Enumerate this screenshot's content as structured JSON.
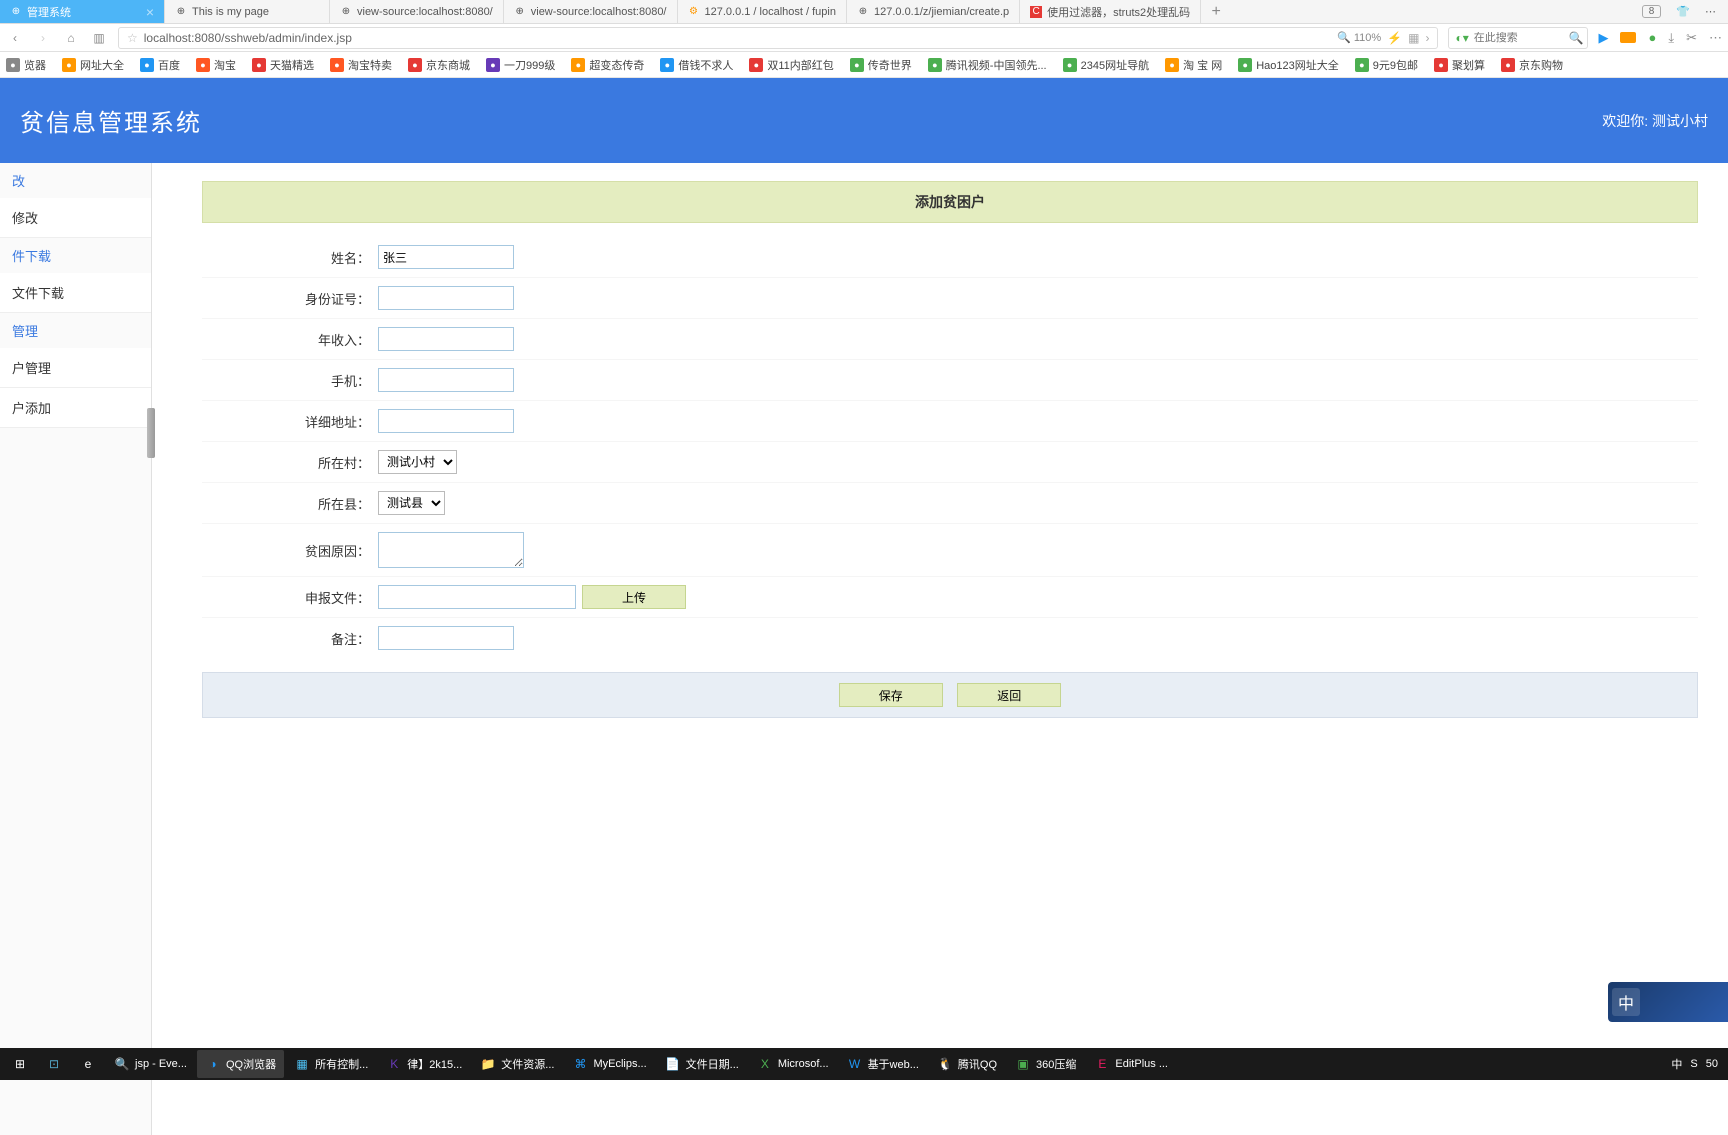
{
  "browser": {
    "tabs": [
      {
        "label": "管理系统",
        "active": true
      },
      {
        "label": "This is my page",
        "active": false
      },
      {
        "label": "view-source:localhost:8080/",
        "active": false
      },
      {
        "label": "view-source:localhost:8080/",
        "active": false
      },
      {
        "label": "127.0.0.1 / localhost / fupin",
        "active": false
      },
      {
        "label": "127.0.0.1/z/jiemian/create.p",
        "active": false
      },
      {
        "label": "使用过滤器，struts2处理乱码",
        "active": false
      }
    ],
    "tab_count": "8",
    "url": "localhost:8080/sshweb/admin/index.jsp",
    "zoom": "110%",
    "search_placeholder": "在此搜索"
  },
  "bookmarks": [
    {
      "label": "览器",
      "color": "#888"
    },
    {
      "label": "网址大全",
      "color": "#ff9800"
    },
    {
      "label": "百度",
      "color": "#2196f3"
    },
    {
      "label": "淘宝",
      "color": "#ff5722"
    },
    {
      "label": "天猫精选",
      "color": "#e53935"
    },
    {
      "label": "淘宝特卖",
      "color": "#ff5722"
    },
    {
      "label": "京东商城",
      "color": "#e53935"
    },
    {
      "label": "一刀999级",
      "color": "#673ab7"
    },
    {
      "label": "超变态传奇",
      "color": "#ff9800"
    },
    {
      "label": "借钱不求人",
      "color": "#2196f3"
    },
    {
      "label": "双11内部红包",
      "color": "#e53935"
    },
    {
      "label": "传奇世界",
      "color": "#4caf50"
    },
    {
      "label": "腾讯视频-中国领先...",
      "color": "#4caf50"
    },
    {
      "label": "2345网址导航",
      "color": "#4caf50"
    },
    {
      "label": "淘 宝 网",
      "color": "#ff9800"
    },
    {
      "label": "Hao123网址大全",
      "color": "#4caf50"
    },
    {
      "label": "9元9包邮",
      "color": "#4caf50"
    },
    {
      "label": "聚划算",
      "color": "#e53935"
    },
    {
      "label": "京东购物",
      "color": "#e53935"
    }
  ],
  "header": {
    "title": "贫信息管理系统",
    "welcome_prefix": "欢迎你: ",
    "welcome_user": "测试小村"
  },
  "sidebar": {
    "groups": [
      {
        "label": "改",
        "items": [
          "修改"
        ]
      },
      {
        "label": "件下载",
        "items": [
          "文件下载"
        ]
      },
      {
        "label": "管理",
        "items": [
          "户管理",
          "户添加"
        ]
      }
    ]
  },
  "form": {
    "title": "添加贫困户",
    "fields": {
      "name": {
        "label": "姓名：",
        "value": "张三"
      },
      "idcard": {
        "label": "身份证号：",
        "value": ""
      },
      "income": {
        "label": "年收入：",
        "value": ""
      },
      "phone": {
        "label": "手机：",
        "value": ""
      },
      "address": {
        "label": "详细地址：",
        "value": ""
      },
      "village": {
        "label": "所在村：",
        "value": "测试小村",
        "options": [
          "测试小村"
        ]
      },
      "county": {
        "label": "所在县：",
        "value": "测试县",
        "options": [
          "测试县"
        ]
      },
      "reason": {
        "label": "贫困原因：",
        "value": ""
      },
      "file": {
        "label": "申报文件：",
        "upload_label": "上传"
      },
      "remark": {
        "label": "备注：",
        "value": ""
      }
    },
    "actions": {
      "save": "保存",
      "back": "返回"
    }
  },
  "float": {
    "zh": "中"
  },
  "taskbar": {
    "items": [
      {
        "label": "",
        "icon": "⊞",
        "color": "#fff"
      },
      {
        "label": "",
        "icon": "⊡",
        "color": "#5ac"
      },
      {
        "label": "",
        "icon": "e",
        "color": "#fff"
      },
      {
        "label": "jsp - Eve...",
        "icon": "🔍",
        "color": "#ff9800"
      },
      {
        "label": "QQ浏览器",
        "icon": "◑",
        "color": "#2196f3",
        "active": true
      },
      {
        "label": "所有控制...",
        "icon": "▦",
        "color": "#4fc3f7"
      },
      {
        "label": "律】2k15...",
        "icon": "K",
        "color": "#673ab7"
      },
      {
        "label": "文件资源...",
        "icon": "📁",
        "color": "#ffc107"
      },
      {
        "label": "MyEclips...",
        "icon": "⌘",
        "color": "#2196f3"
      },
      {
        "label": "文件日期...",
        "icon": "📄",
        "color": "#2196f3"
      },
      {
        "label": "Microsof...",
        "icon": "X",
        "color": "#4caf50"
      },
      {
        "label": "基于web...",
        "icon": "W",
        "color": "#2196f3"
      },
      {
        "label": "腾讯QQ",
        "icon": "🐧",
        "color": "#2196f3"
      },
      {
        "label": "360压缩",
        "icon": "▣",
        "color": "#4caf50"
      },
      {
        "label": "EditPlus ...",
        "icon": "E",
        "color": "#e91e63"
      }
    ],
    "tray": [
      "中",
      "S",
      "50"
    ]
  }
}
